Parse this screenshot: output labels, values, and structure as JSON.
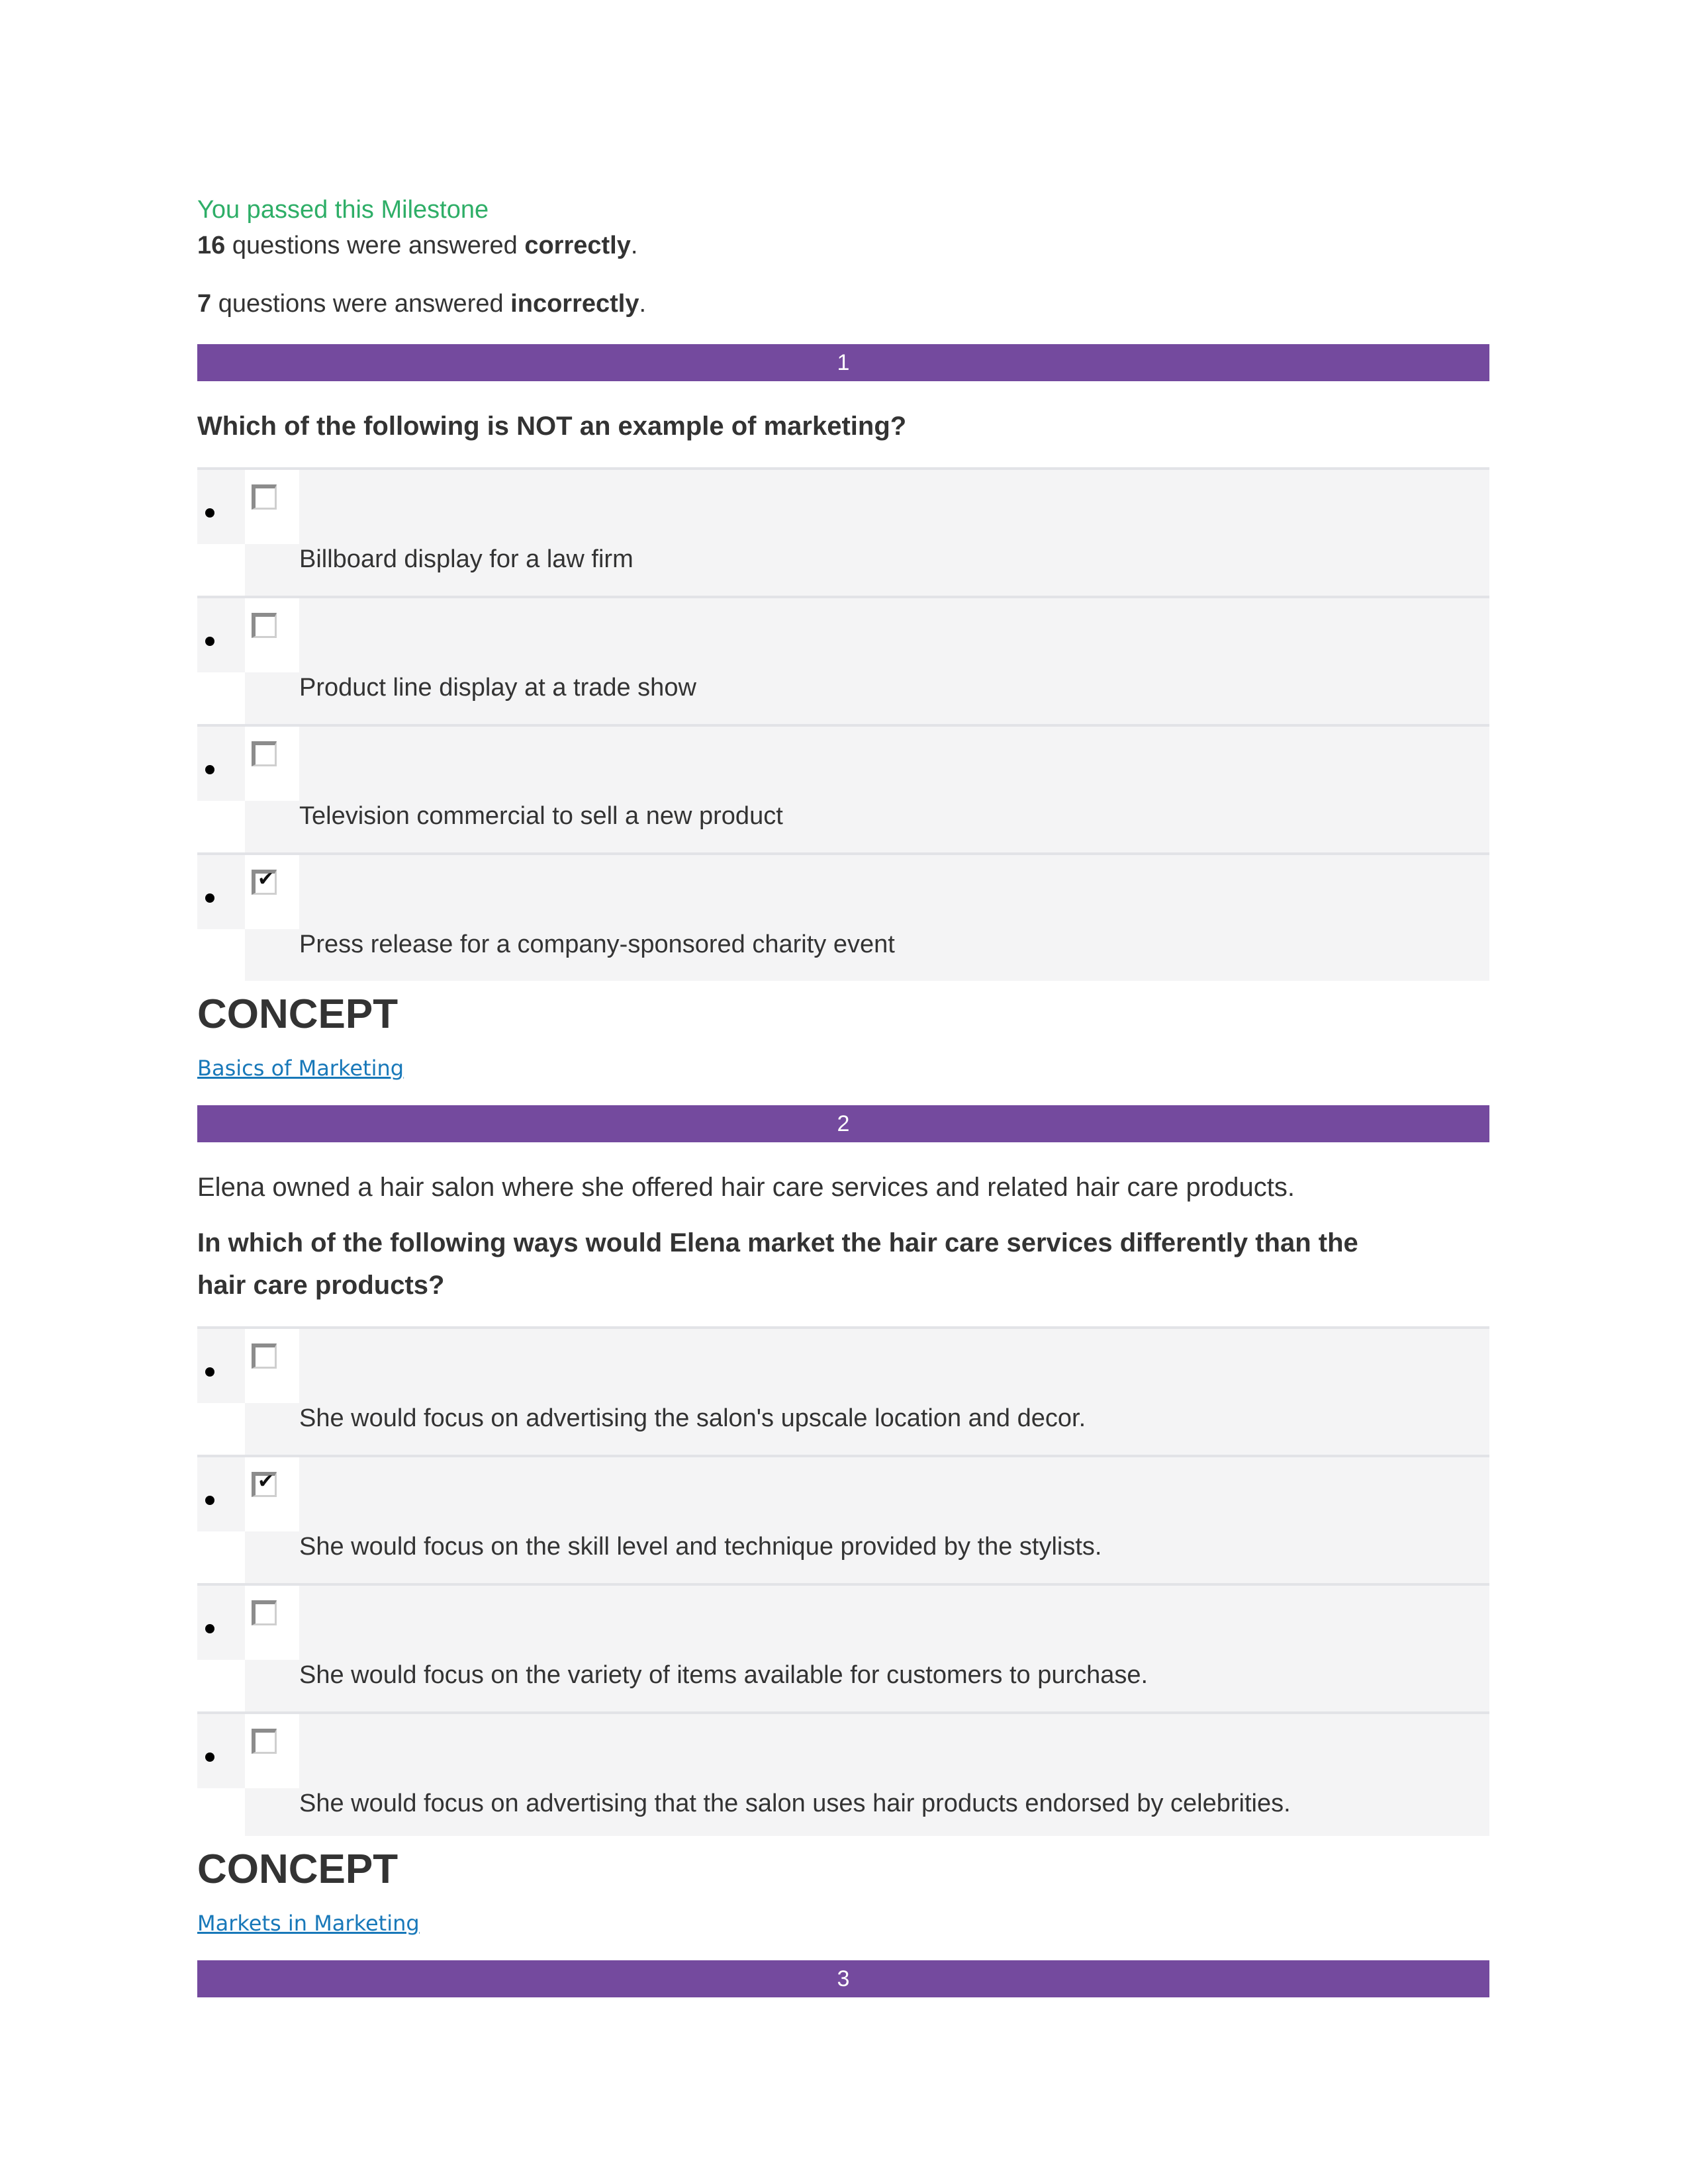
{
  "summary": {
    "passed_text": "You passed this Milestone",
    "correct_count": "16",
    "correct_mid": " questions were answered ",
    "correct_word": "correctly",
    "correct_end": ".",
    "incorrect_count": "7",
    "incorrect_mid": " questions were answered ",
    "incorrect_word": "incorrectly",
    "incorrect_end": "."
  },
  "colors": {
    "banner_purple": "#744A9E",
    "pass_green": "#2EAE67",
    "link_blue": "#1878B9",
    "option_row": "#f4f4f5",
    "option_border": "#e2e3e7",
    "text": "#333333"
  },
  "concept_label": "CONCEPT",
  "questions": [
    {
      "number": "1",
      "scenario": "",
      "prompt": "Which of the following is NOT an example of marketing?",
      "options": [
        {
          "text": "Billboard display for a law firm",
          "checked": false
        },
        {
          "text": "Product line display at a trade show",
          "checked": false
        },
        {
          "text": "Television commercial to sell a new product",
          "checked": false
        },
        {
          "text": "Press release for a company-sponsored charity event",
          "checked": true
        }
      ],
      "concept_link": "Basics of Marketing"
    },
    {
      "number": "2",
      "scenario": "Elena owned a hair salon where she offered hair care services and related hair care products.",
      "prompt": "In which of the following ways would Elena market the hair care services differently than the hair care products?",
      "options": [
        {
          "text": "She would focus on advertising the salon's upscale location and decor.",
          "checked": false
        },
        {
          "text": "She would focus on the skill level and technique provided by the stylists.",
          "checked": true
        },
        {
          "text": "She would focus on the variety of items available for customers to purchase.",
          "checked": false
        },
        {
          "text": "She would focus on advertising that the salon uses hair products endorsed by celebrities.",
          "checked": false
        }
      ],
      "concept_link": "Markets in Marketing"
    },
    {
      "number": "3",
      "scenario": "",
      "prompt": "",
      "options": [],
      "concept_link": ""
    }
  ],
  "checkbox_glyph": "✔"
}
